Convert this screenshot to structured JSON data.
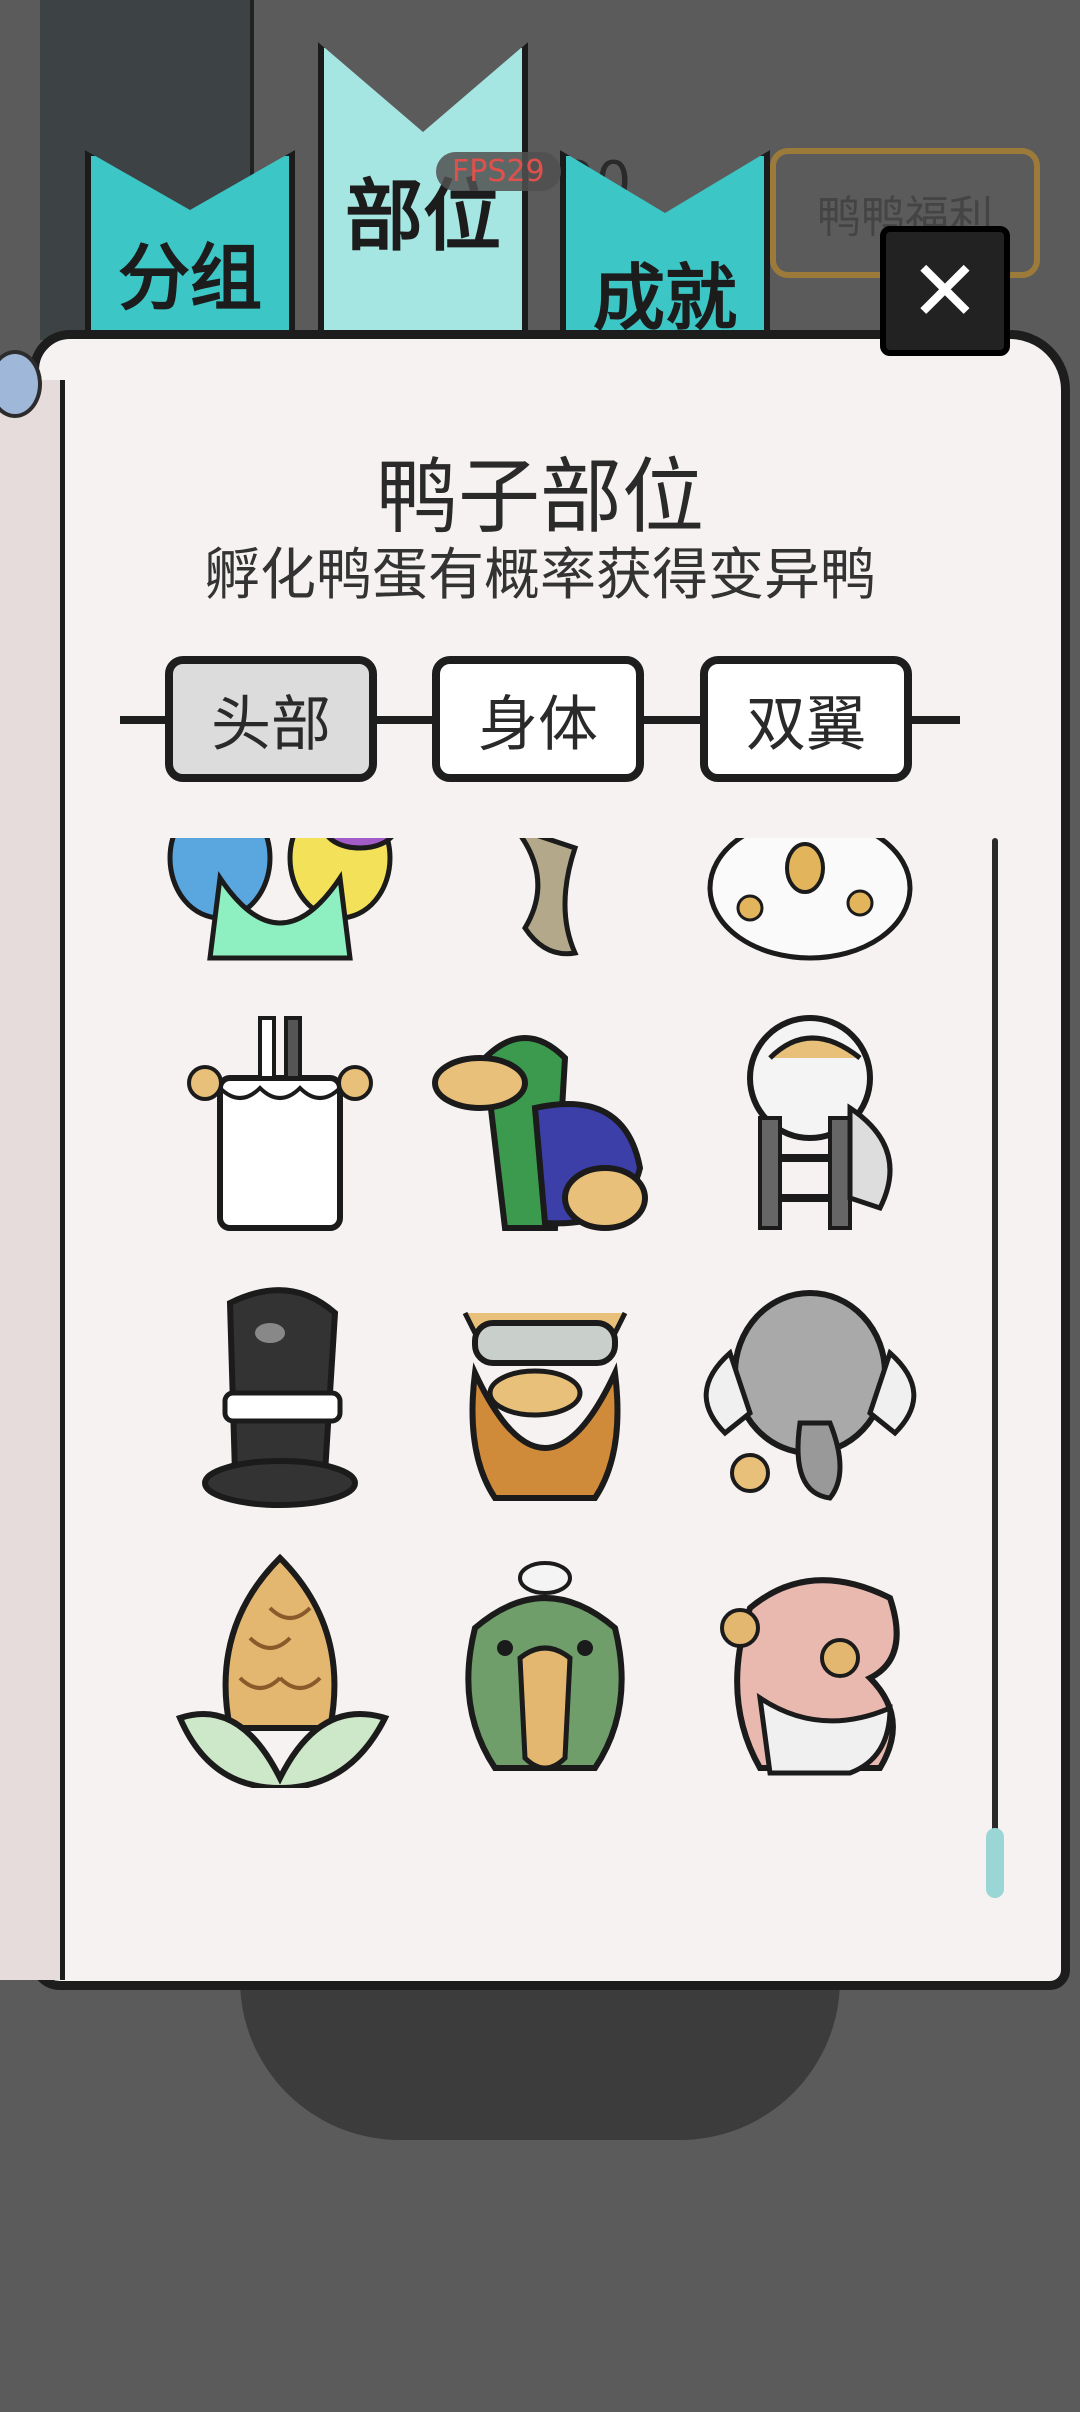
{
  "header": {
    "fps": "FPS29",
    "counter": "20",
    "welfare_label": "鸭鸭福利",
    "close_label": "✕"
  },
  "bookmarks": [
    "分组",
    "部位",
    "成就"
  ],
  "panel": {
    "title": "鸭子部位",
    "subtitle": "孵化鸭蛋有概率获得变异鸭"
  },
  "tabs": [
    {
      "label": "头部",
      "active": true
    },
    {
      "label": "身体",
      "active": false
    },
    {
      "label": "双翼",
      "active": false
    }
  ],
  "items": [
    {
      "name": "rainbow-hair"
    },
    {
      "name": "tree-trunk"
    },
    {
      "name": "chicken-flock"
    },
    {
      "name": "candle-ducks"
    },
    {
      "name": "mallard-bandana"
    },
    {
      "name": "astronaut-ladder"
    },
    {
      "name": "top-hat"
    },
    {
      "name": "viking-beard"
    },
    {
      "name": "elephant"
    },
    {
      "name": "corn"
    },
    {
      "name": "crocodile"
    },
    {
      "name": "worm-ducks"
    }
  ]
}
